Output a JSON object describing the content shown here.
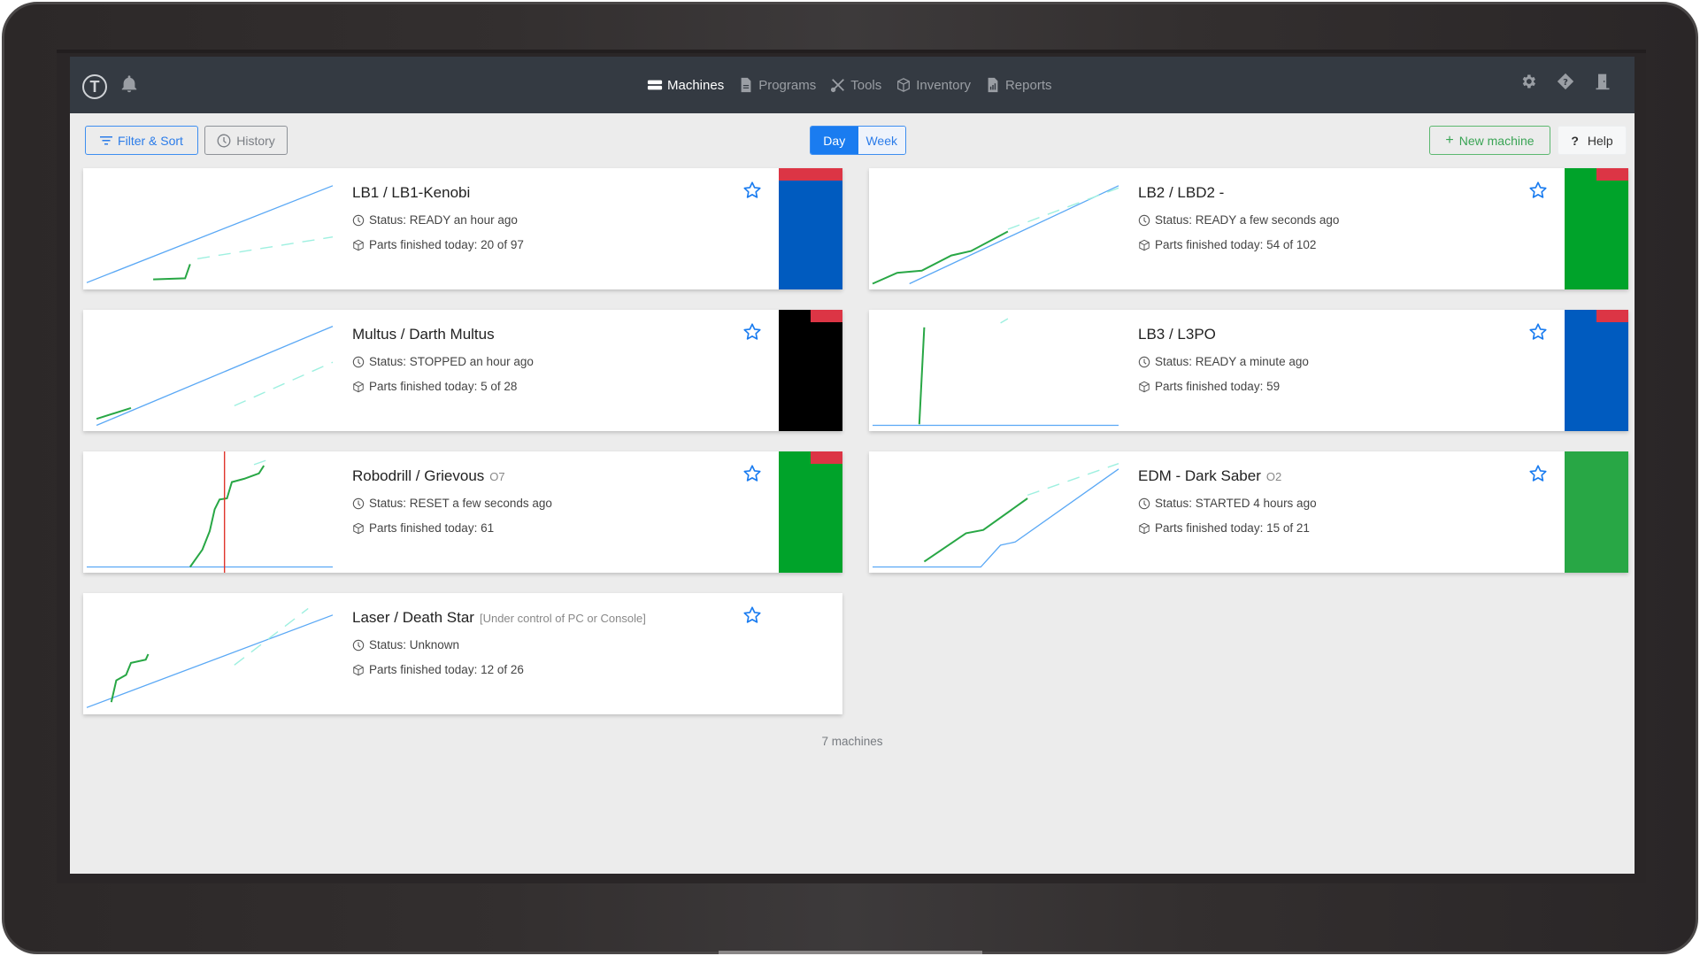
{
  "nav": {
    "logo_letter": "T",
    "items": [
      {
        "label": "Machines",
        "icon": "server-icon",
        "active": true
      },
      {
        "label": "Programs",
        "icon": "file-icon",
        "active": false
      },
      {
        "label": "Tools",
        "icon": "tools-icon",
        "active": false
      },
      {
        "label": "Inventory",
        "icon": "box-icon",
        "active": false
      },
      {
        "label": "Reports",
        "icon": "report-icon",
        "active": false
      }
    ],
    "right_icons": [
      "gear-icon",
      "help-diamond-icon",
      "logout-door-icon"
    ]
  },
  "toolbar": {
    "filter_label": "Filter & Sort",
    "history_label": "History",
    "period_options": [
      "Day",
      "Week"
    ],
    "period_selected": "Day",
    "new_machine_label": "New machine",
    "help_label": "Help"
  },
  "colors": {
    "ready_blue": "#005bbf",
    "green": "#00a32a",
    "started_green": "#28a745",
    "stopped_black": "#000000",
    "alarm_red": "#dc3545",
    "actual_line": "#28a745",
    "target_line": "#5aa8f5",
    "forecast_line": "#9ef0e0"
  },
  "machines": [
    {
      "title": "LB1 / LB1-Kenobi",
      "subtitle": "",
      "status_text": "Status: READY an hour ago",
      "parts_text": "Parts finished today: 20 of 97",
      "strip_color": "#005bbf",
      "flag": 1.0
    },
    {
      "title": "LB2 / LBD2 -",
      "subtitle": "",
      "status_text": "Status: READY a few seconds ago",
      "parts_text": "Parts finished today: 54 of 102",
      "strip_color": "#00a32a",
      "flag": 0.5
    },
    {
      "title": "Multus / Darth Multus",
      "subtitle": "",
      "status_text": "Status: STOPPED an hour ago",
      "parts_text": "Parts finished today: 5 of 28",
      "strip_color": "#000000",
      "flag": 0.5
    },
    {
      "title": "LB3 / L3PO",
      "subtitle": "",
      "status_text": "Status: READY a minute ago",
      "parts_text": "Parts finished today: 59",
      "strip_color": "#005bbf",
      "flag": 0.5
    },
    {
      "title": "Robodrill / Grievous",
      "subtitle": "O7",
      "status_text": "Status: RESET a few seconds ago",
      "parts_text": "Parts finished today: 61",
      "strip_color": "#00a32a",
      "flag": 0.5
    },
    {
      "title": "EDM - Dark Saber",
      "subtitle": "O2",
      "status_text": "Status: STARTED 4 hours ago",
      "parts_text": "Parts finished today: 15 of 21",
      "strip_color": "#28a745",
      "flag": 0
    },
    {
      "title": "Laser / Death Star",
      "subtitle": "[Under control of PC or Console]",
      "status_text": "Status: Unknown",
      "parts_text": "Parts finished today: 12 of 26",
      "strip_color": "",
      "flag": 0
    }
  ],
  "footer": {
    "count_label": "7 machines"
  }
}
